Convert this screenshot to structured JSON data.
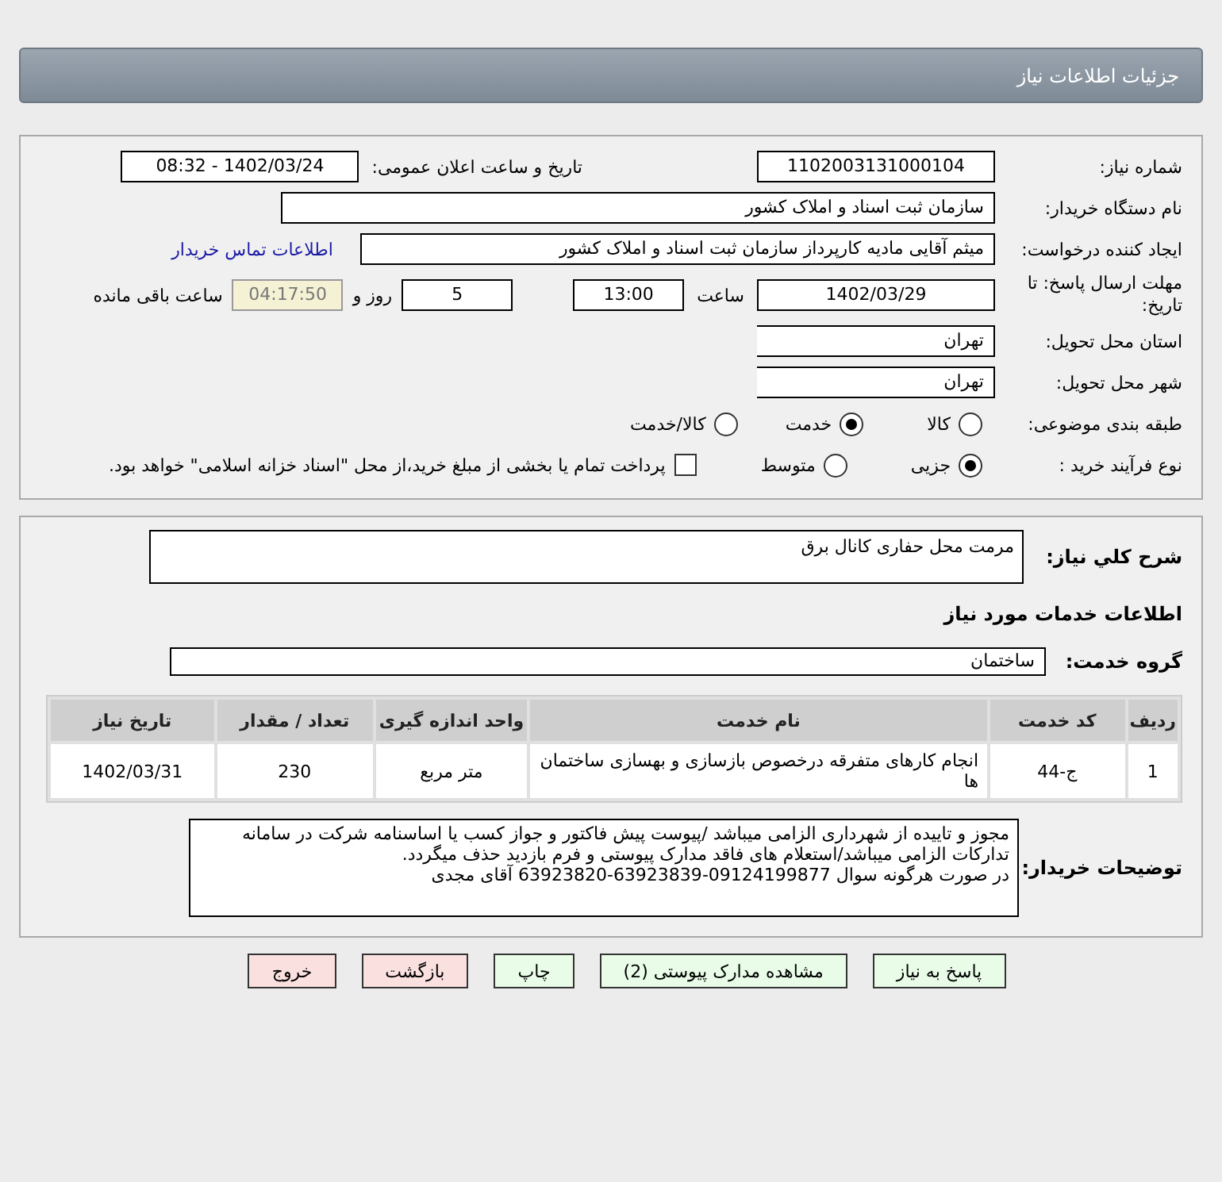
{
  "title": "جزئیات اطلاعات نیاز",
  "need_number": {
    "label": "شماره نیاز:",
    "value": "1102003131000104"
  },
  "announce": {
    "label": "تاریخ و ساعت اعلان عمومی:",
    "value": "1402/03/24 - 08:32"
  },
  "buyer": {
    "label": "نام دستگاه خریدار:",
    "value": "سازمان ثبت اسناد و املاک کشور"
  },
  "creator": {
    "label": "ایجاد کننده درخواست:",
    "value": "میثم آقایی مادیه کارپرداز سازمان ثبت اسناد و املاک کشور",
    "link": "اطلاعات تماس خریدار"
  },
  "deadline": {
    "label": "مهلت ارسال پاسخ: تا تاریخ:",
    "date": "1402/03/29",
    "time_label": "ساعت",
    "time": "13:00",
    "days": "5",
    "days_label": "روز و",
    "remaining": "04:17:50",
    "remaining_label": "ساعت باقی مانده"
  },
  "province": {
    "label": "استان محل تحویل:",
    "value": "تهران"
  },
  "city": {
    "label": "شهر محل تحویل:",
    "value": "تهران"
  },
  "category": {
    "label": "طبقه بندی موضوعی:",
    "options": [
      {
        "label": "کالا",
        "selected": false
      },
      {
        "label": "خدمت",
        "selected": true
      },
      {
        "label": "کالا/خدمت",
        "selected": false
      }
    ]
  },
  "process": {
    "label": "نوع فرآیند خرید :",
    "options": [
      {
        "label": "جزیی",
        "selected": true
      },
      {
        "label": "متوسط",
        "selected": false
      }
    ],
    "payment": {
      "label": "پرداخت تمام یا بخشی از مبلغ خرید،از محل \"اسناد خزانه اسلامی\" خواهد بود.",
      "checked": false
    }
  },
  "summary": {
    "label": "شرح کلي نياز:",
    "value": "مرمت محل حفاری کانال برق"
  },
  "services_heading": "اطلاعات خدمات مورد نیاز",
  "service_group": {
    "label": "گروه خدمت:",
    "value": "ساختمان"
  },
  "table": {
    "columns": [
      "ردیف",
      "کد خدمت",
      "نام خدمت",
      "واحد اندازه گیری",
      "تعداد / مقدار",
      "تاریخ نیاز"
    ],
    "rows": [
      [
        "1",
        "ج-44",
        "انجام کارهای متفرقه درخصوص بازسازی و بهسازی ساختمان ها",
        "متر مربع",
        "230",
        "1402/03/31"
      ]
    ]
  },
  "notes": {
    "label": "توضیحات خریدار:",
    "paragraphs": [
      "مجوز و تاییده از شهرداری الزامی میباشد /پیوست پیش فاکتور و جواز کسب یا اساسنامه شرکت در سامانه تداركات الزامی میباشد/استعلام های فاقد مدارک پیوستی و فرم بازدید حذف میگردد.",
      "در صورت هرگونه سوال 09124199877-63923839-63923820 آقای مجدی"
    ]
  },
  "buttons": [
    {
      "label": "پاسخ به نیاز",
      "kind": "primary"
    },
    {
      "label": "مشاهده مدارک پیوستی (2)",
      "kind": "primary"
    },
    {
      "label": "چاپ",
      "kind": "primary"
    },
    {
      "label": "بازگشت",
      "kind": "danger"
    },
    {
      "label": "خروج",
      "kind": "danger"
    }
  ]
}
